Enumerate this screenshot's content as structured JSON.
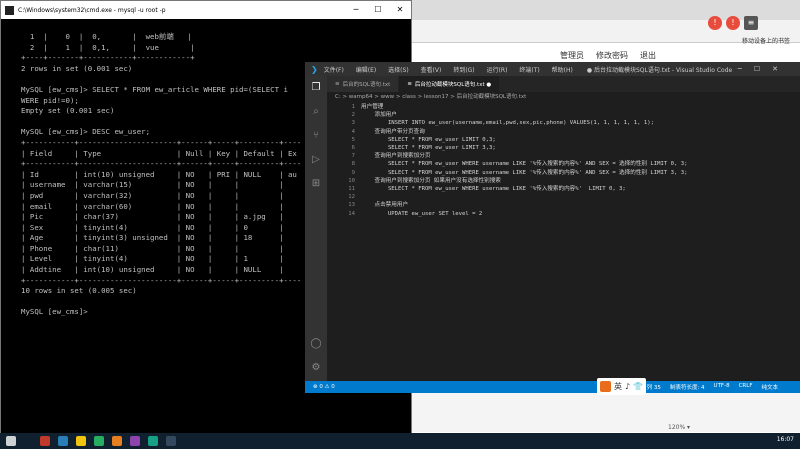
{
  "browser": {
    "nav_items": [
      "管理员",
      "修改密码",
      "退出"
    ],
    "right_note": "移动设备上的书签",
    "zoom": "120% ▾"
  },
  "cmd": {
    "title": "C:\\Windows\\system32\\cmd.exe - mysql -u root -p",
    "lines": [
      "  1  |    0  |  0,       |  web前端   |",
      "  2  |    1  |  0,1,     |  vue       |",
      "+----+-------+-----------+------------+",
      "2 rows in set (0.001 sec)",
      "",
      "MySQL [ew_cms]> SELECT * FROM ew_article WHERE pid=(SELECT i",
      "WERE pid!=0);",
      "Empty set (0.001 sec)",
      "",
      "MySQL [ew_cms]> DESC ew_user;",
      "+-----------+----------------------+------+-----+---------+----",
      "| Field     | Type                 | Null | Key | Default | Ex",
      "+-----------+----------------------+------+-----+---------+----",
      "| Id        | int(10) unsigned     | NO   | PRI | NULL    | au",
      "| username  | varchar(15)          | NO   |     |         |",
      "| pwd       | varchar(32)          | NO   |     |         |",
      "| email     | varchar(60)          | NO   |     |         |",
      "| Pic       | char(37)             | NO   |     | a.jpg   |",
      "| Sex       | tinyint(4)           | NO   |     | 0       |",
      "| Age       | tinyint(3) unsigned  | NO   |     | 18      |",
      "| Phone     | char(11)             | NO   |     |         |",
      "| Level     | tinyint(4)           | NO   |     | 1       |",
      "| Addtine   | int(10) unsigned     | NO   |     | NULL    |",
      "+-----------+----------------------+------+-----+---------+----",
      "10 rows in set (0.005 sec)",
      "",
      "MySQL [ew_cms]>"
    ]
  },
  "vscode": {
    "title": "● 后台拉动截模块SQL语句.txt - Visual Studio Code",
    "menu": [
      "文件(F)",
      "编辑(E)",
      "选择(S)",
      "查看(V)",
      "转到(G)",
      "运行(R)",
      "终端(T)",
      "帮助(H)"
    ],
    "tabs": [
      "后台的SQL语句.txt",
      "后台拉动截模块SQL语句.txt ●"
    ],
    "breadcrumb": "C: > wamp64 > www > class > lesson17 > 后台拉动截模块SQL语句.txt",
    "line_numbers": [
      "1",
      "2",
      "3",
      "4",
      "5",
      "6",
      "7",
      "8",
      "9",
      "10",
      "11",
      "12",
      "13",
      "14"
    ],
    "code_lines": [
      "用户管理",
      "    添加用户",
      "        INSERT INTO ew_user(username,email,pwd,sex,pic,phone) VALUES(1, 1, 1, 1, 1, 1);",
      "    查询用户带分页查询",
      "        SELECT * FROM ew_user LIMIT 0,3;",
      "        SELECT * FROM ew_user LIMIT 3,3;",
      "    查询用户到搜索加分页",
      "        SELECT * FROM ew_user WHERE username LIKE '%传入搜索的内容%' AND SEX = 选择的性别 LIMIT 0, 3;",
      "        SELECT * FROM ew_user WHERE username LIKE '%传入搜索的内容%' AND SEX = 选择的性别 LIMIT 3, 3;",
      "    查询用户到搜索加分页 如果用户没有选择性别搜索",
      "        SELECT * FROM ew_user WHERE username LIKE '%传入搜索的内容%'  LIMIT 0, 3;",
      "",
      "    点击禁用用户",
      "        UPDATE ew_user SET level = 2"
    ],
    "status_left": "⊗ 0 ⚠ 0",
    "status_right": [
      "行 14，列 35",
      "制表符长度: 4",
      "UTF-8",
      "CRLF",
      "纯文本"
    ],
    "ime": [
      "英",
      "♪",
      "👕"
    ]
  },
  "taskbar": {
    "clock": "16:07"
  }
}
